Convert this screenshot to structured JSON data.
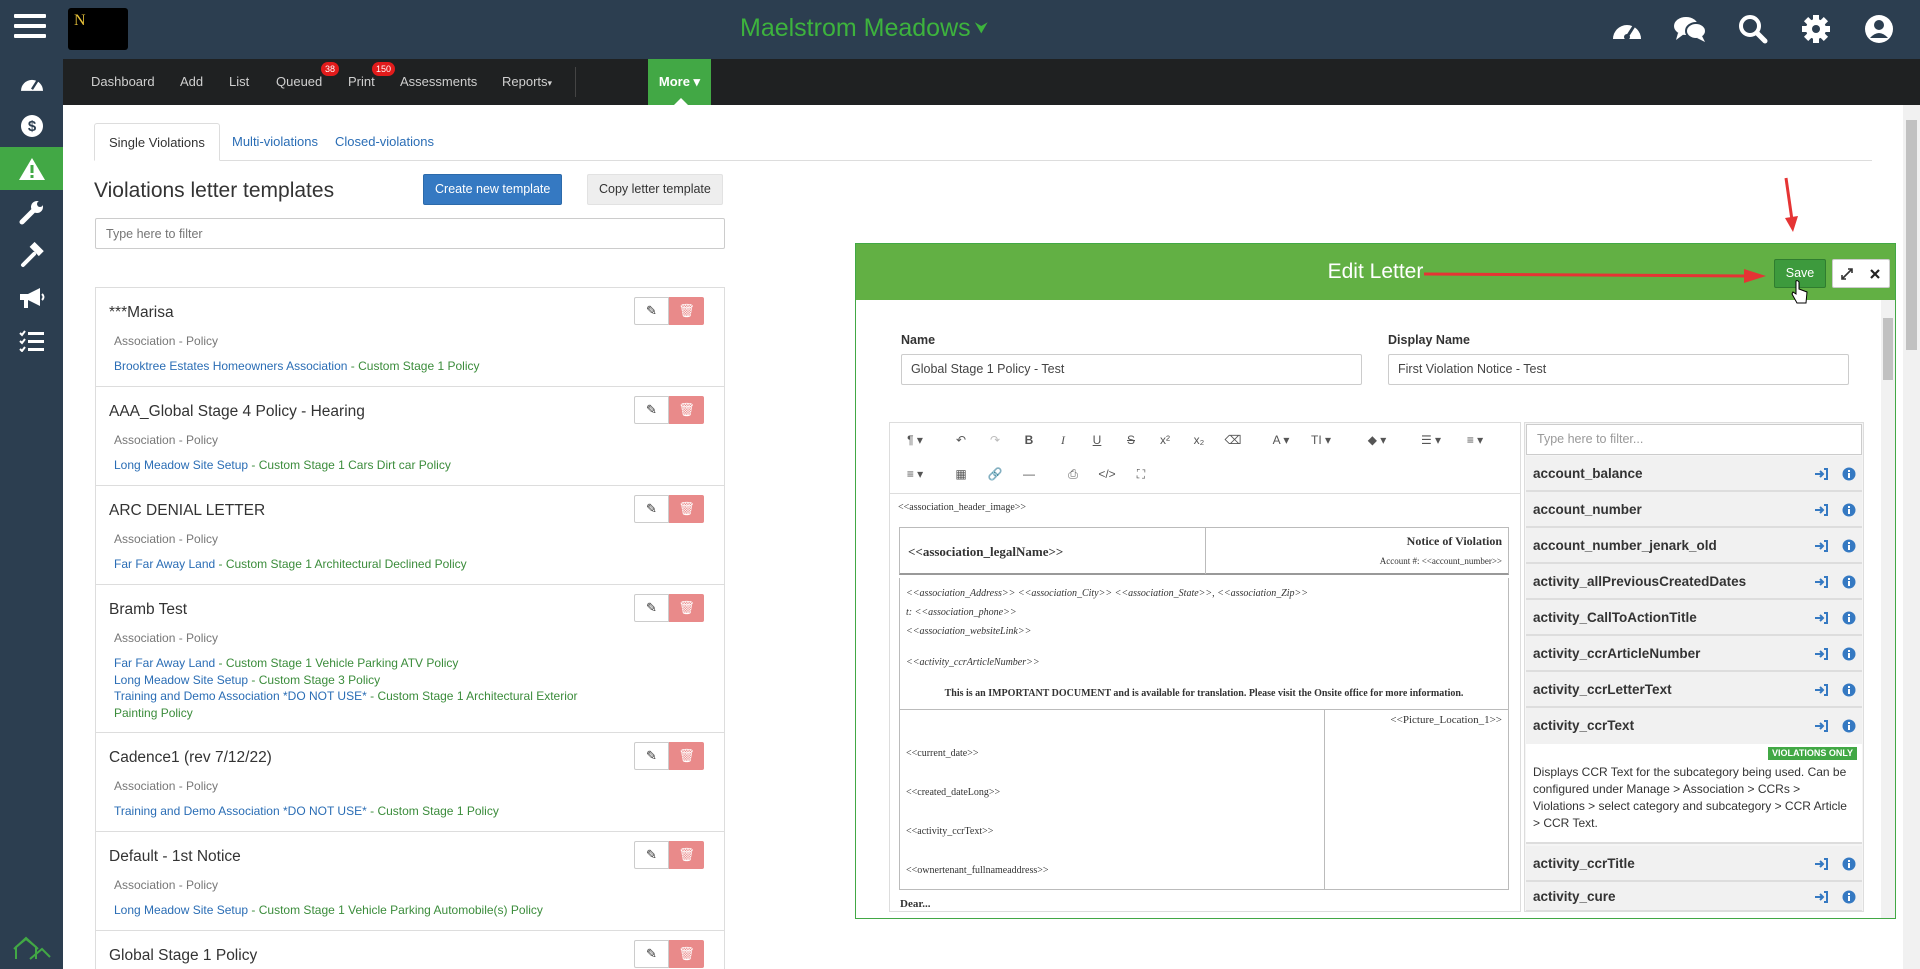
{
  "app": {
    "title": "Maelstrom Meadows",
    "logo_letter": "N"
  },
  "topicons": [
    "dashboard-gauge-icon",
    "chat-icon",
    "search-icon",
    "gear-icon",
    "user-icon"
  ],
  "nav": {
    "items": [
      {
        "label": "Dashboard"
      },
      {
        "label": "Add"
      },
      {
        "label": "List"
      },
      {
        "label": "Queued",
        "badge": "38"
      },
      {
        "label": "Print",
        "badge": "150"
      },
      {
        "label": "Assessments"
      },
      {
        "label": "Reports",
        "caret": "▾"
      }
    ],
    "more": "More ▾"
  },
  "sidebar": [
    "gauge-icon",
    "dollar-icon",
    "warning-icon",
    "wrench-icon",
    "hammer-icon",
    "megaphone-icon",
    "checklist-icon",
    "home-icon"
  ],
  "tabs": [
    "Single Violations",
    "Multi-violations",
    "Closed-violations"
  ],
  "page": {
    "title": "Violations letter templates",
    "create_btn": "Create new template",
    "copy_btn": "Copy letter template",
    "filter_placeholder": "Type here to filter"
  },
  "templates": [
    {
      "name": "***Marisa",
      "type": "Association - Policy",
      "links": [
        {
          "assoc": "Brooktree Estates Homeowners Association",
          "policy": " - Custom Stage 1 Policy"
        }
      ]
    },
    {
      "name": "AAA_Global Stage 4 Policy - Hearing",
      "type": "Association - Policy",
      "links": [
        {
          "assoc": "Long Meadow Site Setup",
          "policy": " - Custom Stage 1 Cars Dirt car Policy"
        }
      ]
    },
    {
      "name": "ARC DENIAL LETTER",
      "type": "Association - Policy",
      "links": [
        {
          "assoc": "Far Far Away Land",
          "policy": " - Custom Stage 1 Architectural Declined Policy"
        }
      ]
    },
    {
      "name": "Bramb Test",
      "type": "Association - Policy",
      "links": [
        {
          "assoc": "Far Far Away Land",
          "policy": " - Custom Stage 1 Vehicle Parking ATV Policy"
        },
        {
          "assoc": "Long Meadow Site Setup",
          "policy": " - Custom Stage 3 Policy"
        },
        {
          "assoc": "Training and Demo Association *DO NOT USE*",
          "policy": " - Custom Stage 1 Architectural Exterior Painting Policy"
        }
      ]
    },
    {
      "name": "Cadence1 (rev 7/12/22)",
      "type": "Association - Policy",
      "links": [
        {
          "assoc": "Training and Demo Association *DO NOT USE*",
          "policy": " - Custom Stage 1 Policy"
        }
      ]
    },
    {
      "name": "Default - 1st Notice",
      "type": "Association - Policy",
      "links": [
        {
          "assoc": "Long Meadow Site Setup",
          "policy": " - Custom Stage 1 Vehicle Parking Automobile(s) Policy"
        }
      ]
    },
    {
      "name": "Global Stage 1 Policy",
      "type": "",
      "links": []
    }
  ],
  "modal": {
    "title": "Edit Letter",
    "save": "Save",
    "name_label": "Name",
    "name_value": "Global Stage 1  Policy - Test",
    "display_label": "Display Name",
    "display_value": "First Violation Notice - Test",
    "skyfield_placeholder": "Type here to filter...",
    "doc": {
      "header_image": "<<association_header_image>>",
      "legal_name": "<<association_legalName>>",
      "notice": "Notice of Violation",
      "account": "Account #: <<account_number>>",
      "address": "<<association_Address>> <<association_City>> <<association_State>>, <<association_Zip>>",
      "phone": "t: <<association_phone>>",
      "website": "<<association_websiteLink>>",
      "article": "<<activity_ccrArticleNumber>>",
      "important": "This is an IMPORTANT DOCUMENT and is available for translation. Please visit the Onsite office for more information.",
      "picture": "<<Picture_Location_1>>",
      "date": "<<current_date>>",
      "created": "<<created_dateLong>>",
      "ccrtext": "<<activity_ccrText>>",
      "owner": "<<ownertenant_fullnameaddress>>",
      "footer": "Dear..."
    },
    "fields": [
      {
        "name": "account_balance"
      },
      {
        "name": "account_number"
      },
      {
        "name": "account_number_jenark_old"
      },
      {
        "name": "activity_allPreviousCreatedDates"
      },
      {
        "name": "activity_CallToActionTitle"
      },
      {
        "name": "activity_ccrArticleNumber"
      },
      {
        "name": "activity_ccrLetterText"
      },
      {
        "name": "activity_ccrText"
      },
      {
        "name": "activity_ccrTitle"
      },
      {
        "name": "activity_cure"
      }
    ],
    "field_desc": "Displays CCR Text for the subcategory being used. Can be configured under Manage > Association > CCRs > Violations > select category and subcategory > CCR Article > CCR Text.",
    "violations_only": "VIOLATIONS ONLY"
  }
}
